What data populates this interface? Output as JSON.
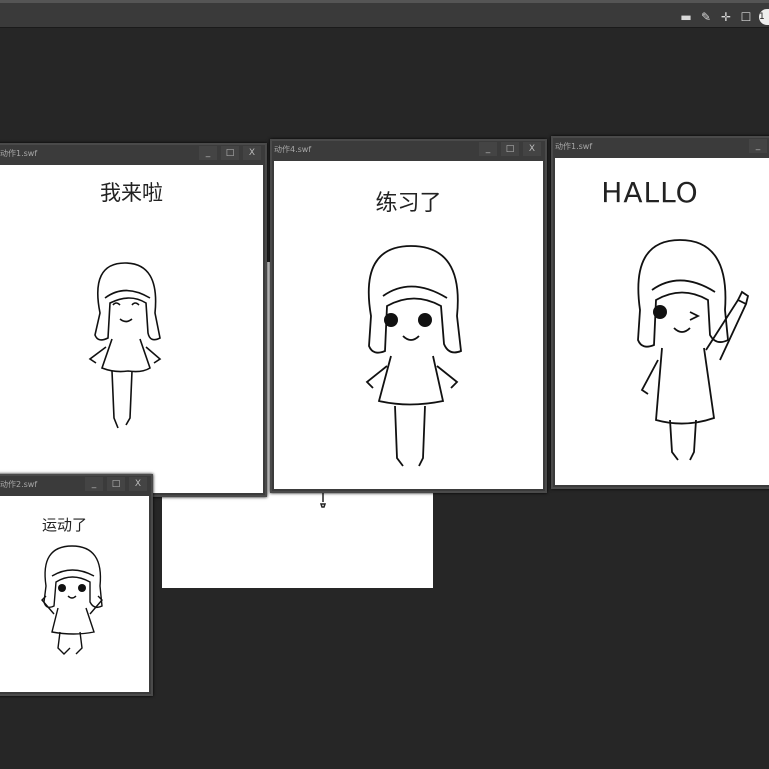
{
  "toolbar": {
    "icons": [
      "film-icon",
      "eyedropper-icon",
      "crosshair-icon",
      "square-icon"
    ],
    "zoom_label": "1"
  },
  "windows": [
    {
      "title": "动作1.swf",
      "caption": "我来啦",
      "minimize": "_",
      "maximize": "□",
      "close": "X"
    },
    {
      "title": "动作4.swf",
      "caption": "练习了",
      "minimize": "_",
      "maximize": "□",
      "close": "X"
    },
    {
      "title": "动作1.swf",
      "caption": "HALLO",
      "minimize": "_"
    },
    {
      "title": "动作2.swf",
      "caption": "运动了",
      "minimize": "_",
      "maximize": "□",
      "close": "X"
    }
  ]
}
